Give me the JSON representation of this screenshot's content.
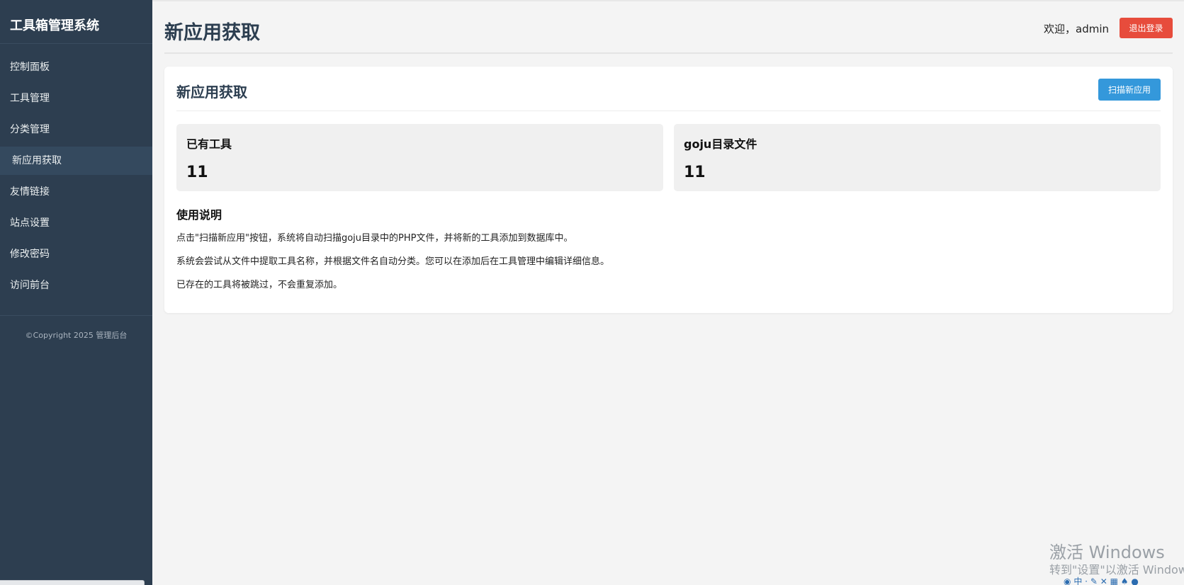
{
  "sidebar": {
    "brand": "工具箱管理系统",
    "items": [
      {
        "label": "控制面板"
      },
      {
        "label": "工具管理"
      },
      {
        "label": "分类管理"
      },
      {
        "label": "新应用获取"
      },
      {
        "label": "友情链接"
      },
      {
        "label": "站点设置"
      },
      {
        "label": "修改密码"
      },
      {
        "label": "访问前台"
      }
    ],
    "active_index": 3,
    "copyright": "©Copyright 2025 管理后台"
  },
  "header": {
    "title": "新应用获取",
    "welcome": "欢迎，admin",
    "logout_label": "退出登录"
  },
  "card": {
    "title": "新应用获取",
    "scan_label": "扫描新应用",
    "stats": [
      {
        "label": "已有工具",
        "value": "11"
      },
      {
        "label": "goju目录文件",
        "value": "11"
      }
    ],
    "instructions": {
      "title": "使用说明",
      "lines": [
        "点击\"扫描新应用\"按钮，系统将自动扫描goju目录中的PHP文件，并将新的工具添加到数据库中。",
        "系统会尝试从文件中提取工具名称，并根据文件名自动分类。您可以在添加后在工具管理中编辑详细信息。",
        "已存在的工具将被跳过，不会重复添加。"
      ]
    }
  },
  "os_watermark": {
    "title": "激活 Windows",
    "subtitle": "转到\"设置\"以激活 Windows。"
  },
  "colors": {
    "sidebar_bg": "#2d3e50",
    "logout_red": "#e74c3c",
    "scan_blue": "#3498db",
    "title_color": "#2c3e50"
  }
}
